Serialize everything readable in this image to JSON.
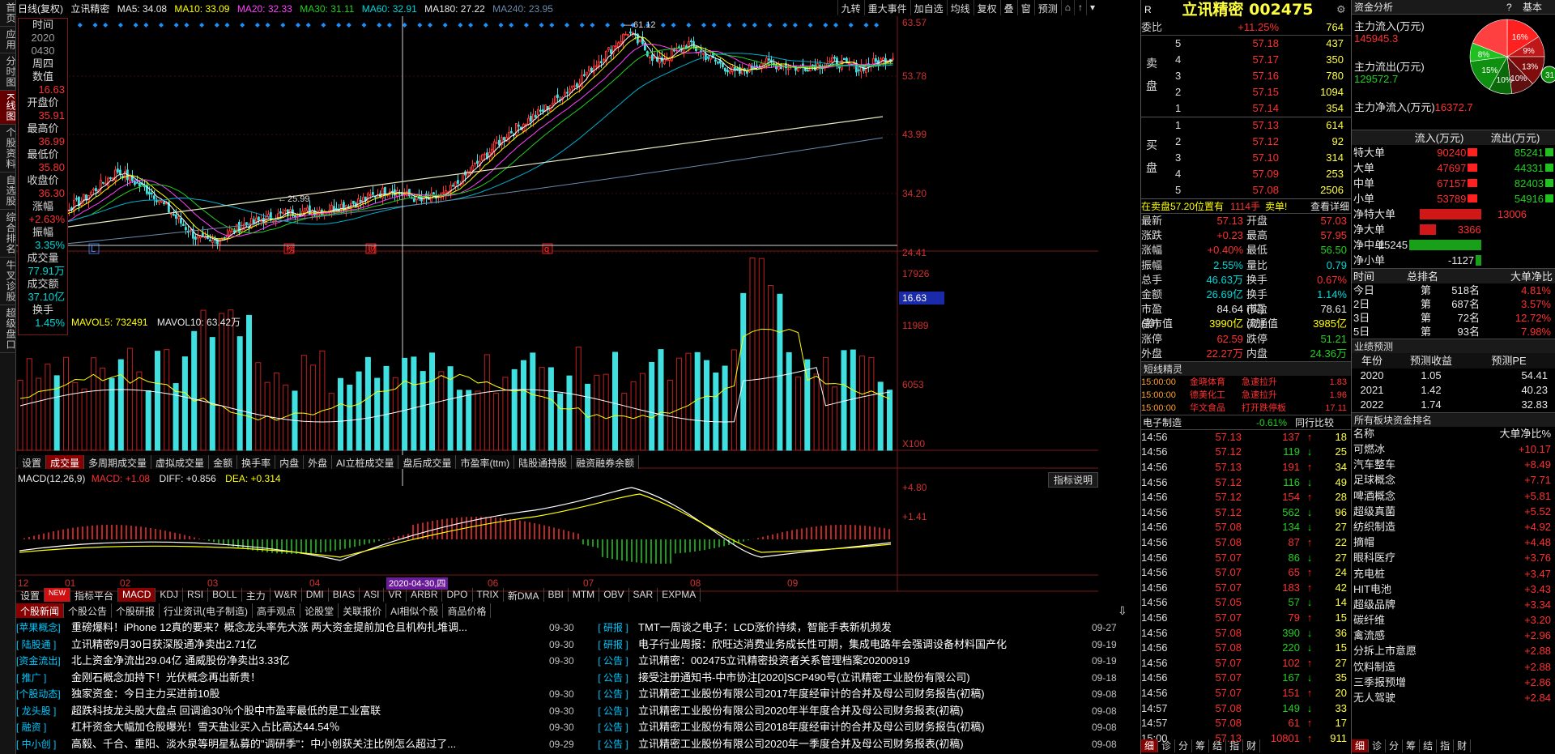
{
  "left_tabs": [
    {
      "label": "首页",
      "on": false
    },
    {
      "label": "应用",
      "on": false
    },
    {
      "label": "分时图",
      "on": false
    },
    {
      "label": "K线图",
      "on": true
    },
    {
      "label": "个股资料",
      "on": false
    },
    {
      "label": "自选股",
      "on": false
    },
    {
      "label": "综合排名",
      "on": false
    },
    {
      "label": "牛叉诊股",
      "on": false
    },
    {
      "label": "超级盘口",
      "on": false
    }
  ],
  "header": {
    "period": "日线(复权)",
    "name": "立讯精密",
    "ma5": "MA5: 34.08",
    "ma10": "MA10: 33.09",
    "ma20": "MA20: 32.33",
    "ma30": "MA30: 31.11",
    "ma60": "MA60: 32.91",
    "ma180": "MA180: 27.22",
    "ma240": "MA240: 23.95"
  },
  "top_buttons": [
    "九转",
    "重大事件",
    "加自选",
    "均线",
    "复权",
    "叠",
    "窗",
    "预测"
  ],
  "info_box": {
    "labels": [
      "时间",
      "周四",
      "开盘价",
      "最高价",
      "最低价",
      "收盘价",
      "涨幅",
      "振幅",
      "成交量",
      "成交额",
      "换手"
    ],
    "date1": "2020",
    "date2": "0430",
    "shuzhi_label": "数值",
    "values": [
      "16.63",
      "35.91",
      "36.99",
      "35.80",
      "36.30",
      "+2.63%",
      "3.35%",
      "77.91万",
      "37.10亿",
      "1.45%"
    ]
  },
  "price_axis": [
    "63.57",
    "53.78",
    "43.99",
    "34.20",
    "24.41",
    "16.63"
  ],
  "annotations": {
    "high": "61.12",
    "low": "25.99"
  },
  "markers": [
    "L",
    "榜",
    "财",
    "q"
  ],
  "vol_header": {
    "mavol5": "MAVOL5: 732491",
    "mavol10": "MAVOL10: 63.42万",
    "lead": "3"
  },
  "vol_axis": [
    "17926",
    "11989",
    "6053",
    "X100"
  ],
  "vol_tabs": [
    "设置",
    "成交量",
    "多周期成交量",
    "虚拟成交量",
    "金额",
    "换手率",
    "内盘",
    "外盘",
    "AI立桩成交量",
    "盘后成交量",
    "市盈率(ttm)",
    "陆股通持股",
    "融资融券余额"
  ],
  "macd_header": {
    "title": "MACD(12,26,9)",
    "macd": "MACD: +1.08",
    "diff": "DIFF: +0.856",
    "dea": "DEA: +0.314",
    "explain": "指标说明"
  },
  "macd_axis": [
    "+4.80",
    "+1.41"
  ],
  "date_axis": [
    "12",
    "01",
    "02",
    "03",
    "04",
    "05",
    "06",
    "07",
    "08",
    "09"
  ],
  "date_cursor": "2020-04-30,四",
  "indicator_tabs": [
    "设置",
    "NEW",
    "指标平台",
    "MACD",
    "KDJ",
    "RSI",
    "BOLL",
    "主力",
    "W&R",
    "DMI",
    "BIAS",
    "ASI",
    "VR",
    "ARBR",
    "DPO",
    "TRIX",
    "新DMA",
    "BBI",
    "MTM",
    "OBV",
    "SAR",
    "EXPMA"
  ],
  "news_tabs": [
    "个股新闻",
    "个股公告",
    "个股研报",
    "行业资讯(电子制造)",
    "高手观点",
    "论股堂",
    "关联报价",
    "AI相似个股",
    "商品价格"
  ],
  "news_left": [
    {
      "tag": "[苹果概念]",
      "title": "重磅爆料！iPhone 12真的要来？概念龙头率先大涨 两大资金提前加仓且机构扎堆调...",
      "date": "09-30"
    },
    {
      "tag": "[ 陆股通 ]",
      "title": "立讯精密9月30日获深股通净卖出2.71亿",
      "date": "09-30"
    },
    {
      "tag": "[资金流出]",
      "title": "北上资金净流出29.04亿 通威股份净卖出3.33亿",
      "date": "09-30"
    },
    {
      "tag": "[ 推广 ]",
      "title": "金刚石概念加持下！光伏概念再出新贵！",
      "date": ""
    },
    {
      "tag": "[个股动态]",
      "title": "独家资金：今日主力买进前10股",
      "date": "09-30"
    },
    {
      "tag": "[ 龙头股 ]",
      "title": "超跌科技龙头股大盘点 回调逾30％个股中市盈率最低的是工业富联",
      "date": "09-30"
    },
    {
      "tag": "[ 融资 ]",
      "title": "杠杆资金大幅加仓股曝光！雪天盐业买入占比高达44.54％",
      "date": "09-30"
    },
    {
      "tag": "[ 中小创 ]",
      "title": "高毅、千合、重阳、淡水泉等明星私募的\"调研季\"：中小创获关注比例怎么超过了...",
      "date": "09-29"
    }
  ],
  "news_right": [
    {
      "tag": "[ 研报 ]",
      "title": "TMT一周谈之电子：LCD涨价持续，智能手表新机频发",
      "date": "09-27"
    },
    {
      "tag": "[ 研报 ]",
      "title": "电子行业周报：欣旺达消费业务成长性可期，集成电路年会强调设备材料国产化",
      "date": "09-19"
    },
    {
      "tag": "[ 公告 ]",
      "title": "立讯精密：002475立讯精密投资者关系管理档案20200919",
      "date": "09-19"
    },
    {
      "tag": "[ 公告 ]",
      "title": "接受注册通知书-中市协注[2020]SCP490号(立讯精密工业股份有限公司)",
      "date": "09-18"
    },
    {
      "tag": "[ 公告 ]",
      "title": "立讯精密工业股份有限公司2017年度经审计的合并及母公司财务报告(初稿)",
      "date": "09-08"
    },
    {
      "tag": "[ 公告 ]",
      "title": "立讯精密工业股份有限公司2020年半年度合并及母公司财务报表(初稿)",
      "date": "09-08"
    },
    {
      "tag": "[ 公告 ]",
      "title": "立讯精密工业股份有限公司2018年度经审计的合并及母公司财务报告(初稿)",
      "date": "09-08"
    },
    {
      "tag": "[ 公告 ]",
      "title": "立讯精密工业股份有限公司2020年一季度合并及母公司财务报表(初稿)",
      "date": "09-08"
    }
  ],
  "quote": {
    "r": "R",
    "title": "立讯精密 002475",
    "webi_label": "委比",
    "webi": "+11.25%",
    "webi_n": "764",
    "sell": [
      {
        "lvl": "5",
        "p": "57.18",
        "v": "437"
      },
      {
        "lvl": "4",
        "p": "57.17",
        "v": "350"
      },
      {
        "lvl": "3",
        "p": "57.16",
        "v": "780"
      },
      {
        "lvl": "2",
        "p": "57.15",
        "v": "1094"
      },
      {
        "lvl": "1",
        "p": "57.14",
        "v": "354"
      }
    ],
    "buy": [
      {
        "lvl": "1",
        "p": "57.13",
        "v": "614"
      },
      {
        "lvl": "2",
        "p": "57.12",
        "v": "92"
      },
      {
        "lvl": "3",
        "p": "57.10",
        "v": "314"
      },
      {
        "lvl": "4",
        "p": "57.09",
        "v": "253"
      },
      {
        "lvl": "5",
        "p": "57.08",
        "v": "2506"
      }
    ],
    "sell_label": "卖盘",
    "buy_label": "买盘",
    "notice": "在卖盘57.20位置有",
    "notice_n": "1114手",
    "notice_s": "卖单!",
    "detail": "查看详细",
    "stats": [
      [
        "最新",
        "57.13",
        "开盘",
        "57.03"
      ],
      [
        "涨跌",
        "+0.23",
        "最高",
        "57.95"
      ],
      [
        "涨幅",
        "+0.40%",
        "最低",
        "56.50"
      ],
      [
        "振幅",
        "2.55%",
        "量比",
        "0.79"
      ],
      [
        "总手",
        "46.63万",
        "换手",
        "0.67%"
      ],
      [
        "金额",
        "26.69亿",
        "换手(实)",
        "1.14%"
      ],
      [
        "市盈(静)",
        "84.64",
        "市盈(动)",
        "78.61"
      ],
      [
        "总市值",
        "3990亿",
        "流通值",
        "3985亿"
      ],
      [
        "涨停",
        "62.59",
        "跌停",
        "51.21"
      ],
      [
        "外盘",
        "22.27万",
        "内盘",
        "24.36万"
      ]
    ],
    "short_title": "短线精灵",
    "short": [
      [
        "15:00:00",
        "金晓体育",
        "急速拉升",
        "1.83"
      ],
      [
        "15:00:00",
        "德美化工",
        "急速拉升",
        "1.96"
      ],
      [
        "15:00:00",
        "华文食品",
        "打开跌停板",
        "17.11"
      ]
    ],
    "industry": "电子制造",
    "industry_chg": "-0.61%",
    "compare": "同行比较",
    "ticks": [
      [
        "14:56",
        "57.13",
        "137",
        "up",
        "18"
      ],
      [
        "14:56",
        "57.12",
        "119",
        "dn",
        "25"
      ],
      [
        "14:56",
        "57.13",
        "191",
        "up",
        "34"
      ],
      [
        "14:56",
        "57.12",
        "116",
        "dn",
        "49"
      ],
      [
        "14:56",
        "57.12",
        "154",
        "up",
        "28"
      ],
      [
        "14:56",
        "57.12",
        "562",
        "dn",
        "96"
      ],
      [
        "14:56",
        "57.08",
        "134",
        "dn",
        "27"
      ],
      [
        "14:56",
        "57.08",
        "87",
        "up",
        "22"
      ],
      [
        "14:56",
        "57.07",
        "86",
        "dn",
        "27"
      ],
      [
        "14:56",
        "57.07",
        "65",
        "up",
        "24"
      ],
      [
        "14:56",
        "57.07",
        "183",
        "up",
        "42"
      ],
      [
        "14:56",
        "57.05",
        "57",
        "dn",
        "14"
      ],
      [
        "14:56",
        "57.07",
        "79",
        "up",
        "15"
      ],
      [
        "14:56",
        "57.08",
        "390",
        "dn",
        "36"
      ],
      [
        "14:56",
        "57.08",
        "220",
        "dn",
        "15"
      ],
      [
        "14:56",
        "57.07",
        "102",
        "up",
        "27"
      ],
      [
        "14:56",
        "57.07",
        "167",
        "dn",
        "35"
      ],
      [
        "14:56",
        "57.07",
        "151",
        "up",
        "20"
      ],
      [
        "14:57",
        "57.08",
        "149",
        "dn",
        "33"
      ],
      [
        "14:57",
        "57.08",
        "61",
        "up",
        "17"
      ],
      [
        "15:00",
        "57.13",
        "10801",
        "up",
        "911"
      ]
    ],
    "bottom_tabs": [
      "细",
      "诊",
      "分",
      "筹",
      "结",
      "指",
      "财"
    ]
  },
  "capital": {
    "title": "资金分析",
    "help": "?",
    "tab": "基本",
    "main_in_label": "主力流入(万元)",
    "main_in": "145945.3",
    "main_out_label": "主力流出(万元)",
    "main_out": "129572.7",
    "net_label": "主力净流入(万元)",
    "net": "16372.7",
    "pie": [
      {
        "label": "16%",
        "color": "#ff2020",
        "pct": 16
      },
      {
        "label": "9%",
        "color": "#c01818",
        "pct": 9
      },
      {
        "label": "13%",
        "color": "#800c0c",
        "pct": 13
      },
      {
        "label": "10%",
        "color": "#601010",
        "pct": 10
      },
      {
        "label": "10%",
        "color": "#0a6a0a",
        "pct": 10
      },
      {
        "label": "15%",
        "color": "#109010",
        "pct": 15
      },
      {
        "label": "8%",
        "color": "#20c020",
        "pct": 8
      },
      {
        "label": "",
        "color": "#ff4040",
        "pct": 19
      }
    ],
    "pie_extra": "31",
    "table_head": [
      "流入(万元)",
      "流出(万元)"
    ],
    "table": [
      [
        "特大单",
        "90240",
        "85241"
      ],
      [
        "大单",
        "47697",
        "44331"
      ],
      [
        "中单",
        "67157",
        "82403"
      ],
      [
        "小单",
        "53789",
        "54916"
      ]
    ],
    "net_rows": [
      [
        "净特大单",
        "13006",
        1.0
      ],
      [
        "净大单",
        "3366",
        0.26
      ],
      [
        "净中单",
        "-15245",
        -1.17
      ],
      [
        "净小单",
        "-1127",
        -0.09
      ]
    ],
    "rank_head": [
      "时间",
      "总排名",
      "大单净比"
    ],
    "rank": [
      [
        "今日",
        "第",
        "518名",
        "4.81%"
      ],
      [
        "2日",
        "第",
        "687名",
        "3.57%"
      ],
      [
        "3日",
        "第",
        "72名",
        "12.72%"
      ],
      [
        "5日",
        "第",
        "93名",
        "7.98%"
      ]
    ],
    "forecast_title": "业绩预测",
    "forecast_head": [
      "年份",
      "预测收益",
      "预测PE"
    ],
    "forecast": [
      [
        "2020",
        "1.05",
        "54.41"
      ],
      [
        "2021",
        "1.42",
        "40.23"
      ],
      [
        "2022",
        "1.74",
        "32.83"
      ]
    ],
    "sector_title": "所有板块资金排名",
    "sector_head": [
      "名称",
      "大单净比%"
    ],
    "sectors": [
      [
        "可燃冰",
        "+10.17"
      ],
      [
        "汽车整车",
        "+8.49"
      ],
      [
        "足球概念",
        "+7.71"
      ],
      [
        "啤酒概念",
        "+5.81"
      ],
      [
        "超级真菌",
        "+5.52"
      ],
      [
        "纺织制造",
        "+4.92"
      ],
      [
        "摘帽",
        "+4.48"
      ],
      [
        "眼科医疗",
        "+3.76"
      ],
      [
        "充电桩",
        "+3.47"
      ],
      [
        "HIT电池",
        "+3.43"
      ],
      [
        "超级品牌",
        "+3.34"
      ],
      [
        "碳纤维",
        "+3.20"
      ],
      [
        "禽流感",
        "+2.96"
      ],
      [
        "分拆上市意愿",
        "+2.88"
      ],
      [
        "饮料制造",
        "+2.88"
      ],
      [
        "三季报预增",
        "+2.86"
      ],
      [
        "无人驾驶",
        "+2.84"
      ]
    ],
    "bottom_tabs": [
      "细",
      "诊",
      "分",
      "筹",
      "结",
      "指",
      "财"
    ]
  }
}
